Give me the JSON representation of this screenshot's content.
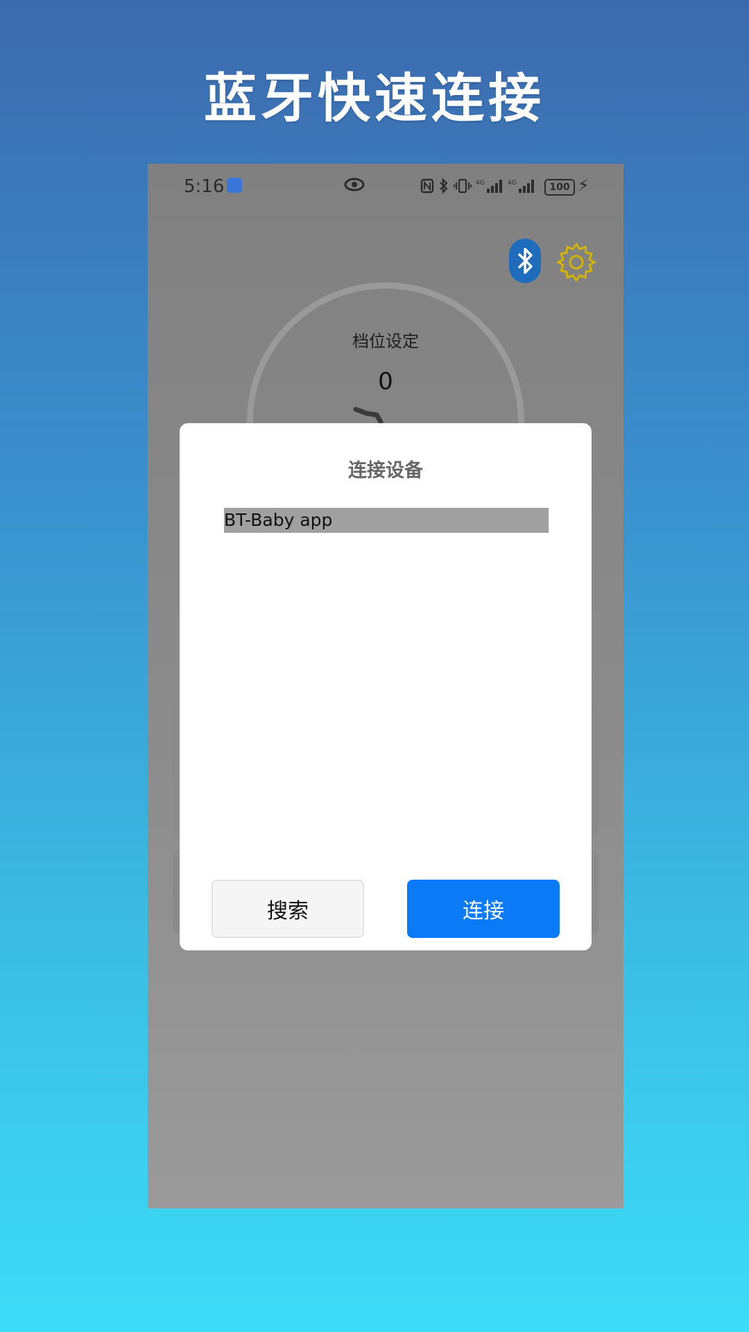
{
  "headline": "蓝牙快速连接",
  "status_bar": {
    "time": "5:16",
    "battery": "100"
  },
  "main": {
    "dial_label": "档位设定",
    "dial_value": "0"
  },
  "dialog": {
    "title": "连接设备",
    "devices": [
      "BT-Baby app"
    ],
    "search_label": "搜索",
    "connect_label": "连接"
  },
  "colors": {
    "accent": "#0a7af7",
    "bluetooth": "#1f6cbd",
    "gear": "#d4b400"
  },
  "icons": {
    "bluetooth": "bluetooth-icon",
    "settings": "gear-icon"
  }
}
